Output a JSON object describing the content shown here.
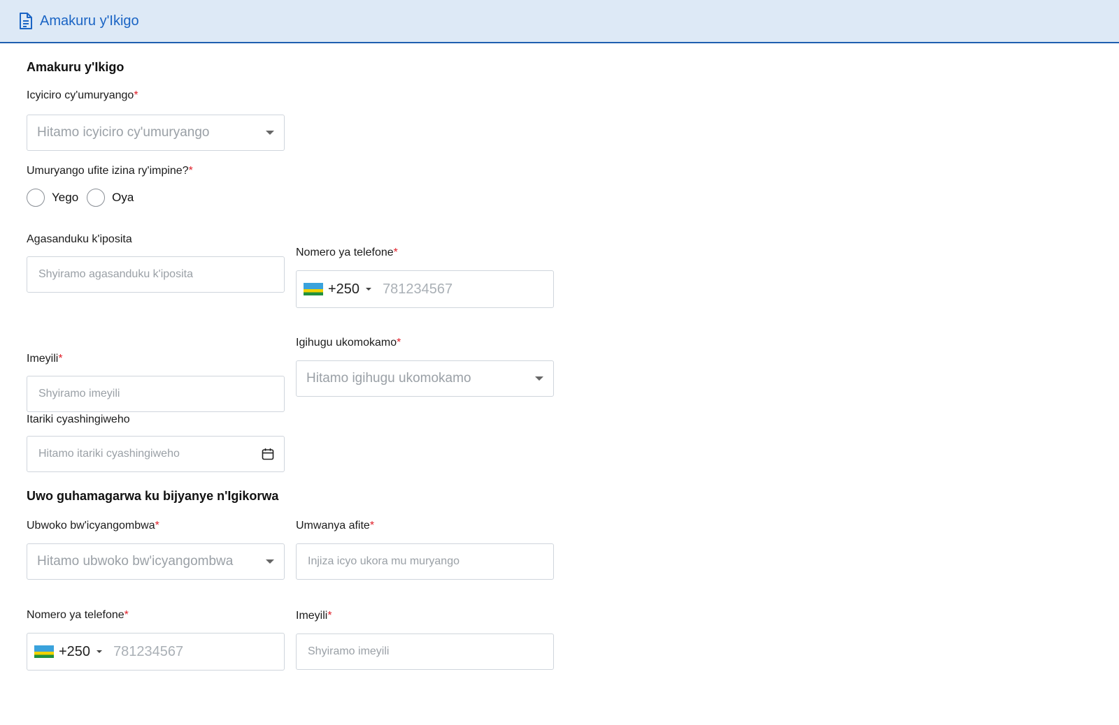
{
  "header": {
    "title": "Amakuru y'Ikigo",
    "icon": "document-icon"
  },
  "section1": {
    "title": "Amakuru y'Ikigo",
    "category": {
      "label": "Icyiciro cy'umuryango",
      "placeholder": "Hitamo icyiciro cy'umuryango"
    },
    "former_name": {
      "label": "Umuryango ufite izina ry'impine?",
      "options": [
        "Yego",
        "Oya"
      ]
    },
    "po_box": {
      "label": "Agasanduku k'iposita",
      "placeholder": "Shyiramo agasanduku k'iposita"
    },
    "phone": {
      "label": "Nomero ya telefone",
      "code": "+250",
      "placeholder": "781234567"
    },
    "email": {
      "label": "Imeyili",
      "placeholder": "Shyiramo imeyili"
    },
    "country": {
      "label": "Igihugu ukomokamo",
      "placeholder": "Hitamo igihugu ukomokamo"
    },
    "date": {
      "label": "Itariki cyashingiweho",
      "placeholder": "Hitamo itariki cyashingiweho"
    }
  },
  "section2": {
    "title": "Uwo guhamagarwa ku bijyanye n'Igikorwa",
    "id_type": {
      "label": "Ubwoko bw'icyangombwa",
      "placeholder": "Hitamo ubwoko bw'icyangombwa"
    },
    "position": {
      "label": "Umwanya afite",
      "placeholder": "Injiza icyo ukora mu muryango"
    },
    "phone": {
      "label": "Nomero ya telefone",
      "code": "+250",
      "placeholder": "781234567"
    },
    "email": {
      "label": "Imeyili",
      "placeholder": "Shyiramo imeyili"
    }
  },
  "required_mark": "*",
  "colors": {
    "accent": "#1a64c4",
    "header_bg": "#dde9f6",
    "required": "#e0202a"
  }
}
